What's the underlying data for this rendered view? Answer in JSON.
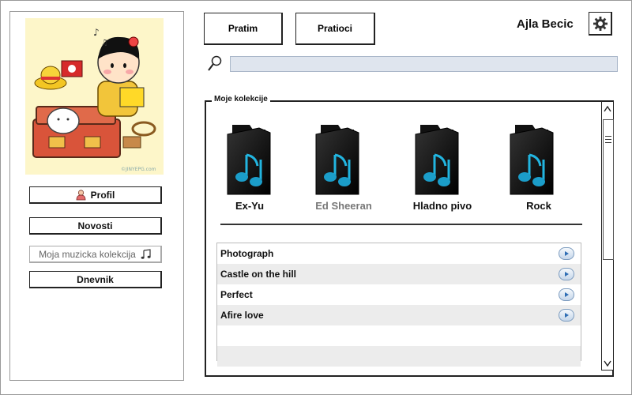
{
  "header": {
    "tabs": [
      {
        "label": "Pratim"
      },
      {
        "label": "Pratioci"
      }
    ],
    "username": "Ajla Becic",
    "settings_icon": "gear-icon"
  },
  "search": {
    "placeholder": "",
    "value": ""
  },
  "sidebar": {
    "avatar_caption": "©JINYEPG.com",
    "buttons": [
      {
        "label": "Profil",
        "icon": "person-icon"
      },
      {
        "label": "Novosti"
      },
      {
        "label": "Moja muzicka kolekcija",
        "icon": "music-note-icon"
      },
      {
        "label": "Dnevnik"
      }
    ]
  },
  "collection": {
    "title": "Moje kolekcije",
    "folders": [
      {
        "label": "Ex-Yu"
      },
      {
        "label": "Ed Sheeran"
      },
      {
        "label": "Hladno pivo"
      },
      {
        "label": "Rock"
      }
    ],
    "songs": [
      {
        "title": "Photograph"
      },
      {
        "title": "Castle on the hill"
      },
      {
        "title": "Perfect"
      },
      {
        "title": "Afire love"
      }
    ]
  },
  "colors": {
    "accent": "#1b9dc9",
    "search_bg": "#dfe5ee",
    "row_alt": "#ececec"
  }
}
